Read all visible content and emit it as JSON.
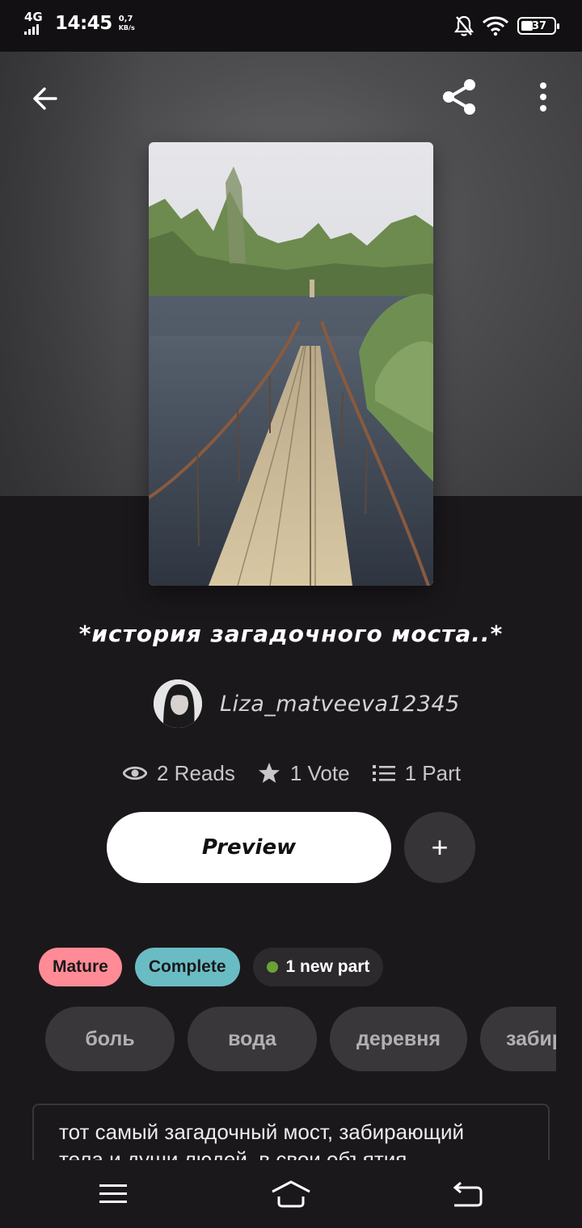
{
  "status_bar": {
    "network": "4G",
    "time": "14:45",
    "speed_value": "0,7",
    "speed_unit": "KB/s",
    "battery": "37",
    "icons": [
      "bell-off-icon",
      "wifi-icon",
      "battery-icon"
    ]
  },
  "header": {
    "back_icon": "arrow-left-icon",
    "share_icon": "share-icon",
    "more_icon": "more-vertical-icon"
  },
  "story": {
    "title": "*история загадочного моста..*",
    "author": "Liza_matveeva12345",
    "stats": {
      "reads": "2 Reads",
      "votes": "1 Vote",
      "parts": "1 Part"
    },
    "preview_label": "Preview",
    "add_label": "+",
    "badges": {
      "mature": "Mature",
      "complete": "Complete",
      "new_part": "1 new part"
    },
    "tags": [
      "боль",
      "вода",
      "деревня",
      "забирающий"
    ],
    "description": "тот самый загадочный мост, забирающий тела и души людей, в свои объятия..."
  },
  "nav": {
    "menu_icon": "menu-icon",
    "home_icon": "home-icon",
    "back_icon": "back-icon"
  },
  "colors": {
    "background": "#1b181b",
    "mature": "#ff8b96",
    "complete": "#6abcc4",
    "new_dot": "#6aa236"
  }
}
